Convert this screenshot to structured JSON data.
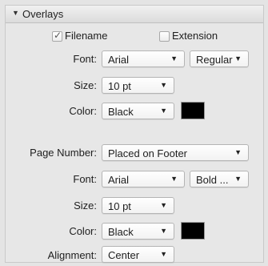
{
  "section": {
    "title": "Overlays",
    "toggle_icon": "disclosure-triangle-icon"
  },
  "filename": {
    "label": "Filename",
    "checked": true,
    "check_glyph": "✓"
  },
  "extension": {
    "label": "Extension",
    "checked": false
  },
  "overlay_font": {
    "label": "Font:",
    "family": "Arial",
    "style": "Regular"
  },
  "overlay_size": {
    "label": "Size:",
    "value": "10 pt"
  },
  "overlay_color": {
    "label": "Color:",
    "value": "Black",
    "swatch": "#000000"
  },
  "page_number": {
    "label": "Page Number:",
    "value": "Placed on Footer"
  },
  "page_font": {
    "label": "Font:",
    "family": "Arial",
    "style": "Bold ..."
  },
  "page_size": {
    "label": "Size:",
    "value": "10 pt"
  },
  "page_color": {
    "label": "Color:",
    "value": "Black",
    "swatch": "#000000"
  },
  "alignment": {
    "label": "Alignment:",
    "value": "Center"
  },
  "icons": {
    "dropdown": "▼",
    "collapse": "▼"
  }
}
